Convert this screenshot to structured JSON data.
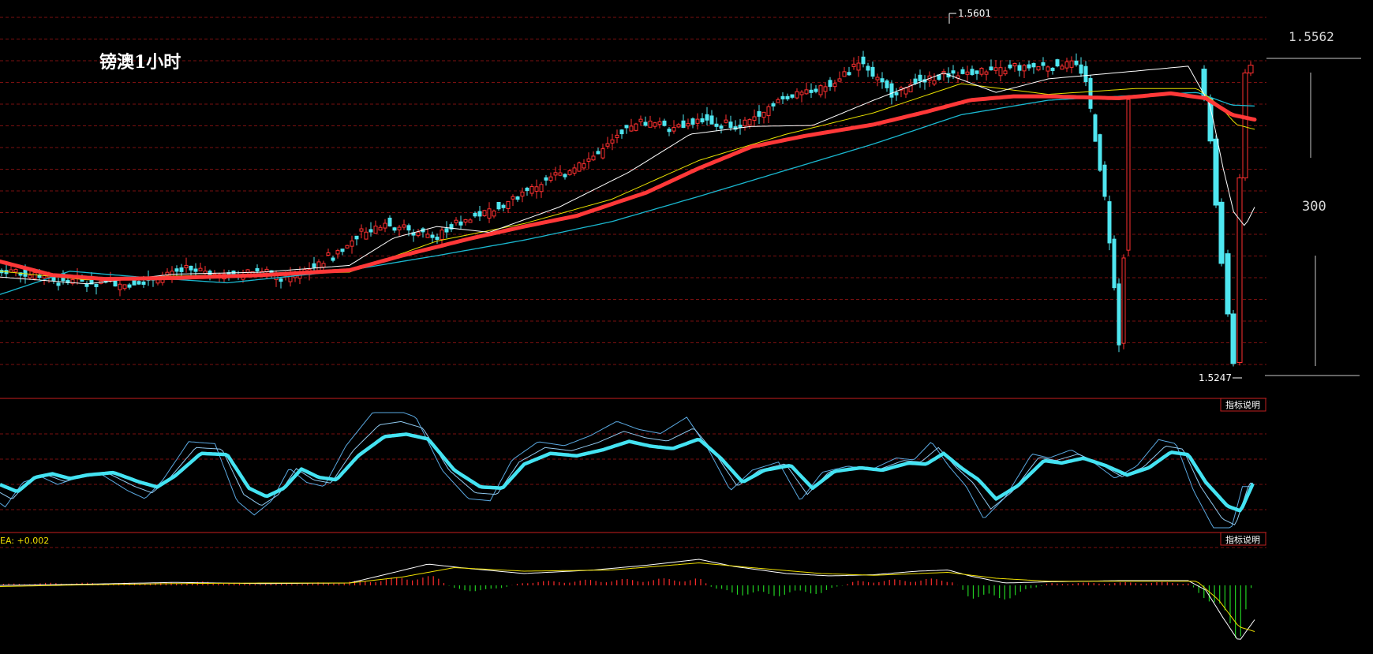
{
  "chart_data": {
    "type": "candlestick",
    "title": "镑澳1小时",
    "high_label": "1.5601",
    "low_label": "1.5247",
    "range_top_label": "1.5562",
    "range_span_label": "300",
    "indicator_button_label": "指标说明",
    "macd_label": "EA: +0.002",
    "price_range": [
      1.5235,
      1.5615
    ],
    "colors": {
      "up": "#ff3030",
      "down": "#4fe6f0",
      "ma_main": "#ff3838",
      "ma_short": "#ffffff",
      "ma_mid": "#e8e000",
      "ma_long": "#1ab8d0",
      "grid": "#7a1010",
      "osc_main": "#44e3f2",
      "osc_thin": "#5aa8e0",
      "macd_pos": "#ff2b2b",
      "macd_neg": "#22d022"
    },
    "price_path": [
      [
        0,
        1.5345
      ],
      [
        40,
        1.534
      ],
      [
        100,
        1.5333
      ],
      [
        160,
        1.533
      ],
      [
        200,
        1.5338
      ],
      [
        240,
        1.5346
      ],
      [
        280,
        1.5338
      ],
      [
        320,
        1.5344
      ],
      [
        360,
        1.5337
      ],
      [
        400,
        1.5349
      ],
      [
        430,
        1.5366
      ],
      [
        460,
        1.5384
      ],
      [
        490,
        1.5394
      ],
      [
        520,
        1.5386
      ],
      [
        550,
        1.5381
      ],
      [
        580,
        1.5392
      ],
      [
        610,
        1.5403
      ],
      [
        640,
        1.5414
      ],
      [
        680,
        1.5432
      ],
      [
        720,
        1.5448
      ],
      [
        760,
        1.5466
      ],
      [
        790,
        1.549
      ],
      [
        820,
        1.5497
      ],
      [
        860,
        1.5493
      ],
      [
        890,
        1.55
      ],
      [
        930,
        1.5491
      ],
      [
        960,
        1.5505
      ],
      [
        990,
        1.5523
      ],
      [
        1030,
        1.5529
      ],
      [
        1060,
        1.554
      ],
      [
        1090,
        1.5562
      ],
      [
        1110,
        1.5543
      ],
      [
        1130,
        1.5526
      ],
      [
        1160,
        1.554
      ],
      [
        1200,
        1.5545
      ],
      [
        1240,
        1.555
      ],
      [
        1280,
        1.5552
      ],
      [
        1320,
        1.5555
      ],
      [
        1360,
        1.5558
      ],
      [
        1375,
        1.5545
      ],
      [
        1388,
        1.548
      ],
      [
        1400,
        1.542
      ],
      [
        1412,
        1.533
      ],
      [
        1418,
        1.527
      ],
      [
        1424,
        1.536
      ],
      [
        1430,
        1.552
      ],
      [
        1436,
        1.5555
      ]
    ],
    "ma_main_path": [
      [
        0,
        1.5354
      ],
      [
        60,
        1.534
      ],
      [
        120,
        1.5336
      ],
      [
        200,
        1.5337
      ],
      [
        300,
        1.534
      ],
      [
        400,
        1.5345
      ],
      [
        460,
        1.536
      ],
      [
        540,
        1.5378
      ],
      [
        600,
        1.539
      ],
      [
        660,
        1.5401
      ],
      [
        740,
        1.5425
      ],
      [
        800,
        1.545
      ],
      [
        860,
        1.5472
      ],
      [
        920,
        1.5483
      ],
      [
        1000,
        1.5495
      ],
      [
        1060,
        1.5508
      ],
      [
        1110,
        1.552
      ],
      [
        1160,
        1.5524
      ],
      [
        1200,
        1.5524
      ],
      [
        1280,
        1.5522
      ],
      [
        1340,
        1.5527
      ],
      [
        1380,
        1.5522
      ],
      [
        1410,
        1.5505
      ],
      [
        1436,
        1.55
      ]
    ],
    "ma_long_path": [
      [
        0,
        1.532
      ],
      [
        80,
        1.5344
      ],
      [
        160,
        1.5338
      ],
      [
        260,
        1.5332
      ],
      [
        400,
        1.5345
      ],
      [
        500,
        1.536
      ],
      [
        600,
        1.5376
      ],
      [
        700,
        1.5395
      ],
      [
        800,
        1.5421
      ],
      [
        900,
        1.5448
      ],
      [
        1000,
        1.5475
      ],
      [
        1100,
        1.5505
      ],
      [
        1200,
        1.552
      ],
      [
        1300,
        1.5525
      ],
      [
        1370,
        1.5528
      ],
      [
        1410,
        1.5515
      ],
      [
        1436,
        1.5514
      ]
    ],
    "ma_mid_path": [
      [
        0,
        1.5344
      ],
      [
        100,
        1.5335
      ],
      [
        200,
        1.5339
      ],
      [
        400,
        1.5343
      ],
      [
        500,
        1.5375
      ],
      [
        600,
        1.5393
      ],
      [
        700,
        1.5418
      ],
      [
        800,
        1.5458
      ],
      [
        900,
        1.5485
      ],
      [
        1000,
        1.5507
      ],
      [
        1100,
        1.5537
      ],
      [
        1200,
        1.5526
      ],
      [
        1300,
        1.5532
      ],
      [
        1370,
        1.5532
      ],
      [
        1395,
        1.5515
      ],
      [
        1415,
        1.5495
      ],
      [
        1436,
        1.549
      ]
    ],
    "ma_short_path": [
      [
        0,
        1.5338
      ],
      [
        100,
        1.5331
      ],
      [
        200,
        1.5341
      ],
      [
        300,
        1.5343
      ],
      [
        400,
        1.535
      ],
      [
        450,
        1.5378
      ],
      [
        500,
        1.539
      ],
      [
        560,
        1.5384
      ],
      [
        640,
        1.541
      ],
      [
        720,
        1.5446
      ],
      [
        790,
        1.5485
      ],
      [
        860,
        1.5493
      ],
      [
        930,
        1.5494
      ],
      [
        1000,
        1.552
      ],
      [
        1080,
        1.5548
      ],
      [
        1110,
        1.5538
      ],
      [
        1140,
        1.5528
      ],
      [
        1200,
        1.5542
      ],
      [
        1300,
        1.555
      ],
      [
        1360,
        1.5555
      ],
      [
        1385,
        1.5515
      ],
      [
        1400,
        1.545
      ],
      [
        1412,
        1.5405
      ],
      [
        1425,
        1.539
      ],
      [
        1436,
        1.541
      ]
    ],
    "oscillator_path": [
      [
        0,
        0.38
      ],
      [
        20,
        0.32
      ],
      [
        40,
        0.44
      ],
      [
        60,
        0.47
      ],
      [
        80,
        0.43
      ],
      [
        100,
        0.46
      ],
      [
        130,
        0.48
      ],
      [
        160,
        0.4
      ],
      [
        180,
        0.36
      ],
      [
        200,
        0.45
      ],
      [
        230,
        0.64
      ],
      [
        260,
        0.63
      ],
      [
        285,
        0.35
      ],
      [
        305,
        0.28
      ],
      [
        325,
        0.35
      ],
      [
        345,
        0.51
      ],
      [
        365,
        0.44
      ],
      [
        385,
        0.42
      ],
      [
        410,
        0.62
      ],
      [
        440,
        0.78
      ],
      [
        465,
        0.8
      ],
      [
        490,
        0.76
      ],
      [
        520,
        0.5
      ],
      [
        550,
        0.36
      ],
      [
        575,
        0.35
      ],
      [
        600,
        0.55
      ],
      [
        630,
        0.64
      ],
      [
        660,
        0.62
      ],
      [
        690,
        0.67
      ],
      [
        720,
        0.74
      ],
      [
        745,
        0.7
      ],
      [
        770,
        0.68
      ],
      [
        800,
        0.76
      ],
      [
        825,
        0.6
      ],
      [
        850,
        0.4
      ],
      [
        875,
        0.5
      ],
      [
        905,
        0.54
      ],
      [
        930,
        0.35
      ],
      [
        955,
        0.49
      ],
      [
        985,
        0.52
      ],
      [
        1010,
        0.5
      ],
      [
        1040,
        0.56
      ],
      [
        1060,
        0.55
      ],
      [
        1080,
        0.64
      ],
      [
        1100,
        0.52
      ],
      [
        1120,
        0.42
      ],
      [
        1140,
        0.26
      ],
      [
        1165,
        0.37
      ],
      [
        1195,
        0.58
      ],
      [
        1215,
        0.56
      ],
      [
        1240,
        0.6
      ],
      [
        1265,
        0.54
      ],
      [
        1290,
        0.46
      ],
      [
        1315,
        0.52
      ],
      [
        1340,
        0.65
      ],
      [
        1360,
        0.63
      ],
      [
        1380,
        0.4
      ],
      [
        1405,
        0.2
      ],
      [
        1420,
        0.16
      ],
      [
        1436,
        0.42
      ]
    ],
    "macd_hist": [
      [
        10,
        0.03
      ],
      [
        40,
        0.04
      ],
      [
        80,
        0.05
      ],
      [
        120,
        0.04
      ],
      [
        160,
        0.05
      ],
      [
        200,
        0.06
      ],
      [
        240,
        0.07
      ],
      [
        280,
        0.04
      ],
      [
        320,
        0.03
      ],
      [
        360,
        0.05
      ],
      [
        400,
        0.07
      ],
      [
        440,
        0.12
      ],
      [
        480,
        0.18
      ],
      [
        500,
        0.15
      ],
      [
        520,
        -0.08
      ],
      [
        560,
        -0.12
      ],
      [
        600,
        0.07
      ],
      [
        640,
        0.08
      ],
      [
        680,
        0.1
      ],
      [
        720,
        0.11
      ],
      [
        760,
        0.12
      ],
      [
        800,
        0.13
      ],
      [
        820,
        -0.1
      ],
      [
        860,
        -0.2
      ],
      [
        900,
        -0.18
      ],
      [
        940,
        -0.14
      ],
      [
        980,
        0.08
      ],
      [
        1020,
        0.1
      ],
      [
        1060,
        0.12
      ],
      [
        1090,
        0.1
      ],
      [
        1110,
        -0.22
      ],
      [
        1140,
        -0.3
      ],
      [
        1170,
        -0.15
      ],
      [
        1200,
        0.04
      ],
      [
        1260,
        0.05
      ],
      [
        1320,
        0.06
      ],
      [
        1360,
        0.05
      ],
      [
        1380,
        -0.25
      ],
      [
        1400,
        -0.7
      ],
      [
        1418,
        -1.0
      ],
      [
        1436,
        0.2
      ]
    ],
    "macd_line": [
      [
        0,
        0.0
      ],
      [
        100,
        0.02
      ],
      [
        200,
        0.05
      ],
      [
        300,
        0.03
      ],
      [
        400,
        0.04
      ],
      [
        440,
        0.18
      ],
      [
        490,
        0.36
      ],
      [
        540,
        0.28
      ],
      [
        600,
        0.2
      ],
      [
        680,
        0.26
      ],
      [
        740,
        0.34
      ],
      [
        800,
        0.44
      ],
      [
        840,
        0.32
      ],
      [
        900,
        0.2
      ],
      [
        950,
        0.16
      ],
      [
        1000,
        0.18
      ],
      [
        1050,
        0.24
      ],
      [
        1085,
        0.26
      ],
      [
        1110,
        0.16
      ],
      [
        1150,
        0.04
      ],
      [
        1200,
        0.06
      ],
      [
        1280,
        0.08
      ],
      [
        1360,
        0.08
      ],
      [
        1380,
        -0.08
      ],
      [
        1400,
        -0.55
      ],
      [
        1418,
        -0.95
      ],
      [
        1436,
        -0.58
      ]
    ],
    "signal_line": [
      [
        0,
        -0.02
      ],
      [
        100,
        0.01
      ],
      [
        200,
        0.03
      ],
      [
        300,
        0.04
      ],
      [
        400,
        0.04
      ],
      [
        460,
        0.14
      ],
      [
        520,
        0.3
      ],
      [
        600,
        0.24
      ],
      [
        700,
        0.26
      ],
      [
        800,
        0.38
      ],
      [
        860,
        0.3
      ],
      [
        940,
        0.2
      ],
      [
        1000,
        0.17
      ],
      [
        1085,
        0.22
      ],
      [
        1140,
        0.12
      ],
      [
        1200,
        0.07
      ],
      [
        1300,
        0.07
      ],
      [
        1370,
        0.07
      ],
      [
        1395,
        -0.25
      ],
      [
        1418,
        -0.7
      ],
      [
        1436,
        -0.78
      ]
    ]
  }
}
